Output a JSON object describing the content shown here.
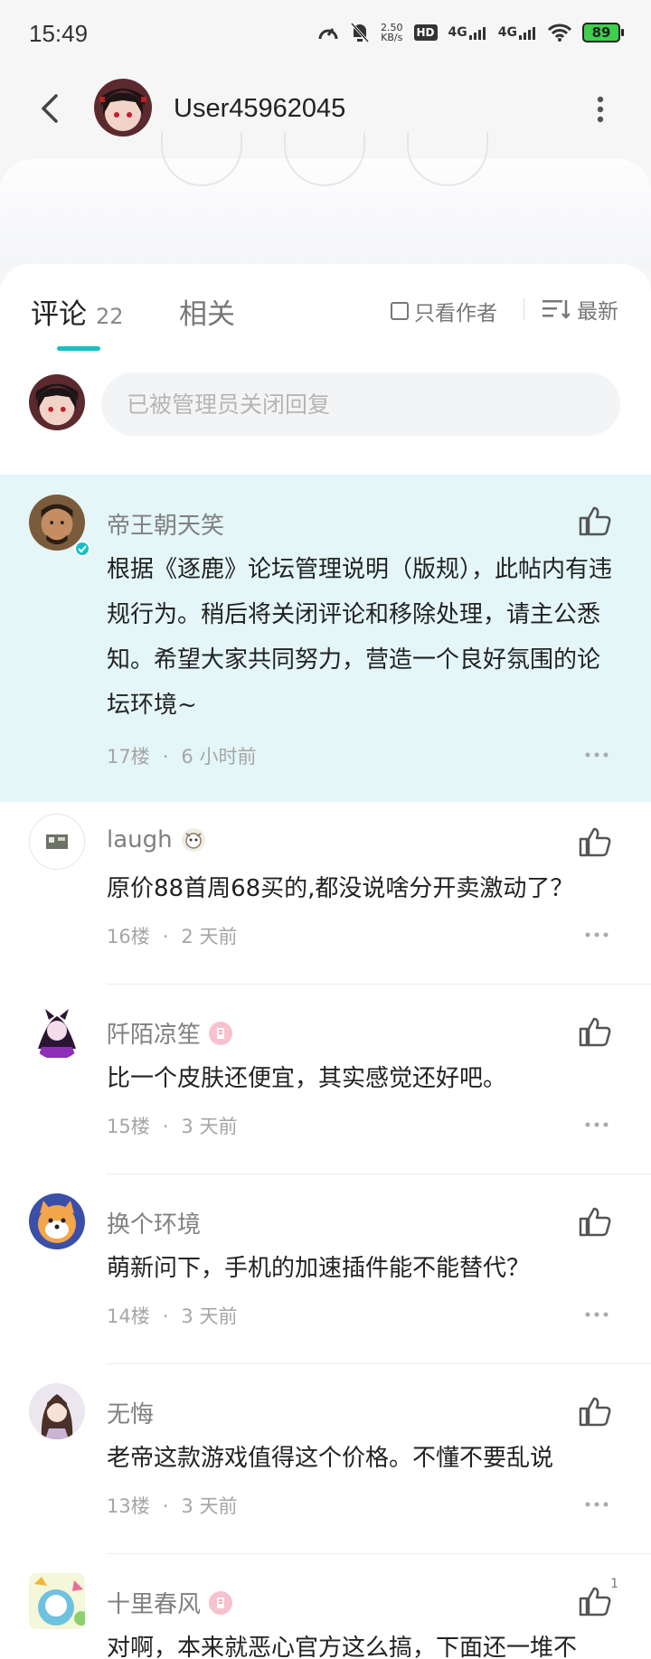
{
  "status_bar": {
    "time": "15:49",
    "net_speed_value": "2.50",
    "net_speed_unit": "KB/s",
    "hd_label": "HD",
    "net_1": "4G",
    "net_2": "4G",
    "battery": "89"
  },
  "header": {
    "username": "User45962045"
  },
  "tabs": {
    "comments_label": "评论",
    "comments_count": "22",
    "related_label": "相关",
    "only_author_label": "只看作者",
    "sort_label": "最新"
  },
  "reply": {
    "placeholder": "已被管理员关闭回复"
  },
  "comments": [
    {
      "name": "帝王朝天笑",
      "text": "根据《逐鹿》论坛管理说明（版规），此帖内有违规行为。稍后将关闭评论和移除处理，请主公悉知。希望大家共同努力，营造一个良好氛围的论坛环境~",
      "floor": "17楼",
      "time": "6 小时前",
      "pinned": true
    },
    {
      "name": "laugh",
      "text": "原价88首周68买的,都没说啥分开卖激动了？",
      "floor": "16楼",
      "time": "2 天前"
    },
    {
      "name": "阡陌凉笙",
      "text": "比一个皮肤还便宜，其实感觉还好吧。",
      "floor": "15楼",
      "time": "3 天前"
    },
    {
      "name": "换个环境",
      "text": "萌新问下，手机的加速插件能不能替代？",
      "floor": "14楼",
      "time": "3 天前"
    },
    {
      "name": "无悔",
      "text": "老帝这款游戏值得这个价格。不懂不要乱说",
      "floor": "13楼",
      "time": "3 天前"
    },
    {
      "name": "十里春风",
      "text": "对啊，本来就恶心官方这么搞，下面还一堆不",
      "like_count": "1"
    }
  ],
  "colors": {
    "accent": "#19bfc6",
    "pinned_bg": "#e4f6f7",
    "battery": "#3ecf4e"
  }
}
